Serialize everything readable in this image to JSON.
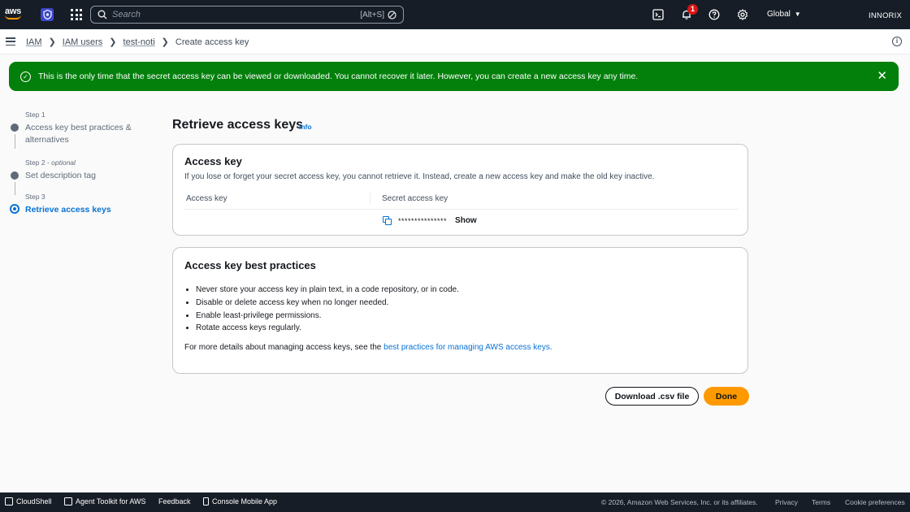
{
  "topnav": {
    "logo_text": "aws",
    "search_placeholder": "Search",
    "search_shortcut": "[Alt+S]",
    "notification_count": "1",
    "region": "Global",
    "account": "INNORIX"
  },
  "breadcrumb": {
    "items": [
      "IAM",
      "IAM users",
      "test-noti"
    ],
    "current": "Create access key"
  },
  "flash": {
    "message": "This is the only time that the secret access key can be viewed or downloaded. You cannot recover it later. However, you can create a new access key any time."
  },
  "steps": [
    {
      "label": "Step 1",
      "optional": "",
      "title": "Access key best practices & alternatives"
    },
    {
      "label": "Step 2",
      "optional": "optional",
      "title": "Set description tag"
    },
    {
      "label": "Step 3",
      "optional": "",
      "title": "Retrieve access keys"
    }
  ],
  "main": {
    "title": "Retrieve access keys",
    "info": "Info",
    "access_key_card": {
      "title": "Access key",
      "description": "If you lose or forget your secret access key, you cannot retrieve it. Instead, create a new access key and make the old key inactive.",
      "col_access_key": "Access key",
      "col_secret": "Secret access key",
      "secret_mask": "***************",
      "show_label": "Show"
    },
    "best_practices_card": {
      "title": "Access key best practices",
      "items": [
        "Never store your access key in plain text, in a code repository, or in code.",
        "Disable or delete access key when no longer needed.",
        "Enable least-privilege permissions.",
        "Rotate access keys regularly."
      ],
      "more_prefix": "For more details about managing access keys, see the ",
      "more_link": "best practices for managing AWS access keys."
    },
    "buttons": {
      "download": "Download .csv file",
      "done": "Done"
    }
  },
  "footer": {
    "cloudshell": "CloudShell",
    "agent_toolkit": "Agent Toolkit for AWS",
    "feedback": "Feedback",
    "mobile_app": "Console Mobile App",
    "copyright": "© 2026, Amazon Web Services, Inc. or its affiliates.",
    "privacy": "Privacy",
    "terms": "Terms",
    "cookies": "Cookie preferences"
  },
  "colors": {
    "nav_bg": "#161d26",
    "flash_green": "#037f0c",
    "link_blue": "#0972d3",
    "primary_orange": "#ff9900"
  }
}
